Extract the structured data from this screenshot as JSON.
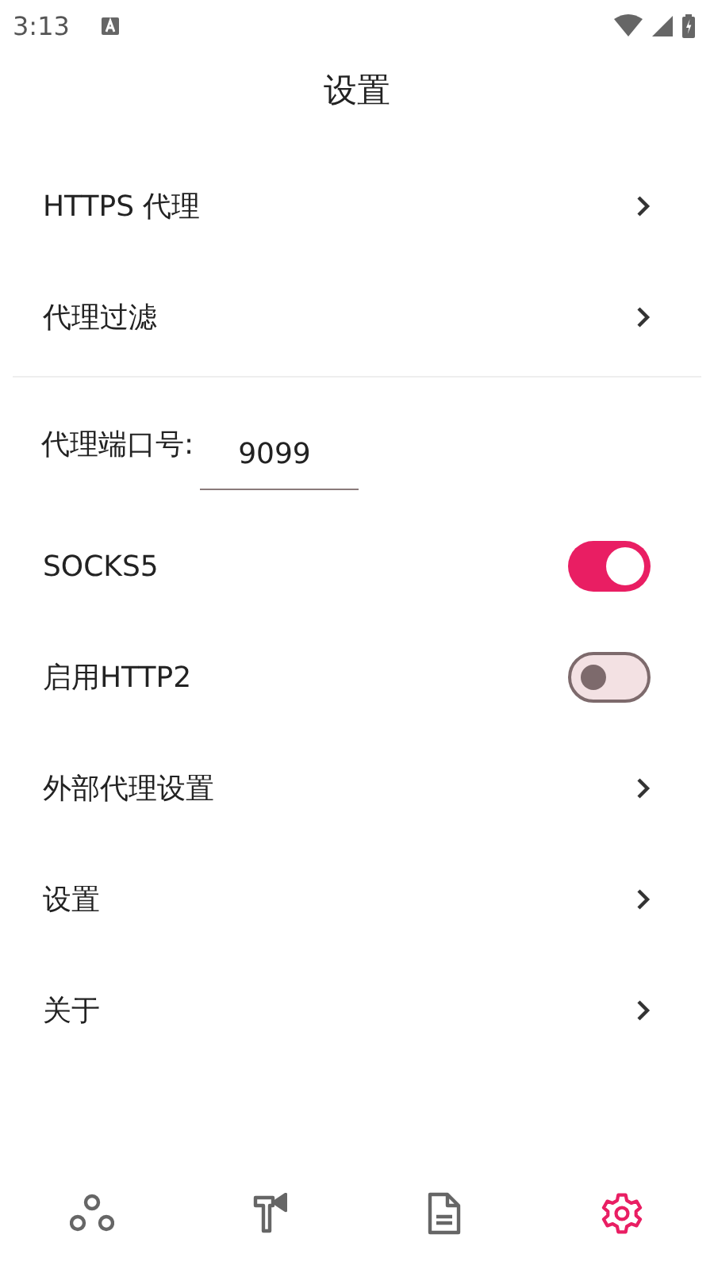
{
  "status_bar": {
    "time": "3:13"
  },
  "title": "设置",
  "groups": [
    {
      "items": [
        {
          "kind": "link",
          "label": "HTTPS 代理"
        },
        {
          "kind": "link",
          "label": "代理过滤"
        }
      ]
    },
    {
      "items": [
        {
          "kind": "field",
          "label": "代理端口号:",
          "value": "9099"
        },
        {
          "kind": "switch",
          "label": "SOCKS5",
          "on": true
        },
        {
          "kind": "switch",
          "label": "启用HTTP2",
          "on": false
        },
        {
          "kind": "link",
          "label": "外部代理设置"
        },
        {
          "kind": "link",
          "label": "设置"
        },
        {
          "kind": "link",
          "label": "关于"
        }
      ]
    }
  ],
  "nav": [
    {
      "selected": false
    },
    {
      "selected": false
    },
    {
      "selected": false
    },
    {
      "selected": true
    }
  ]
}
